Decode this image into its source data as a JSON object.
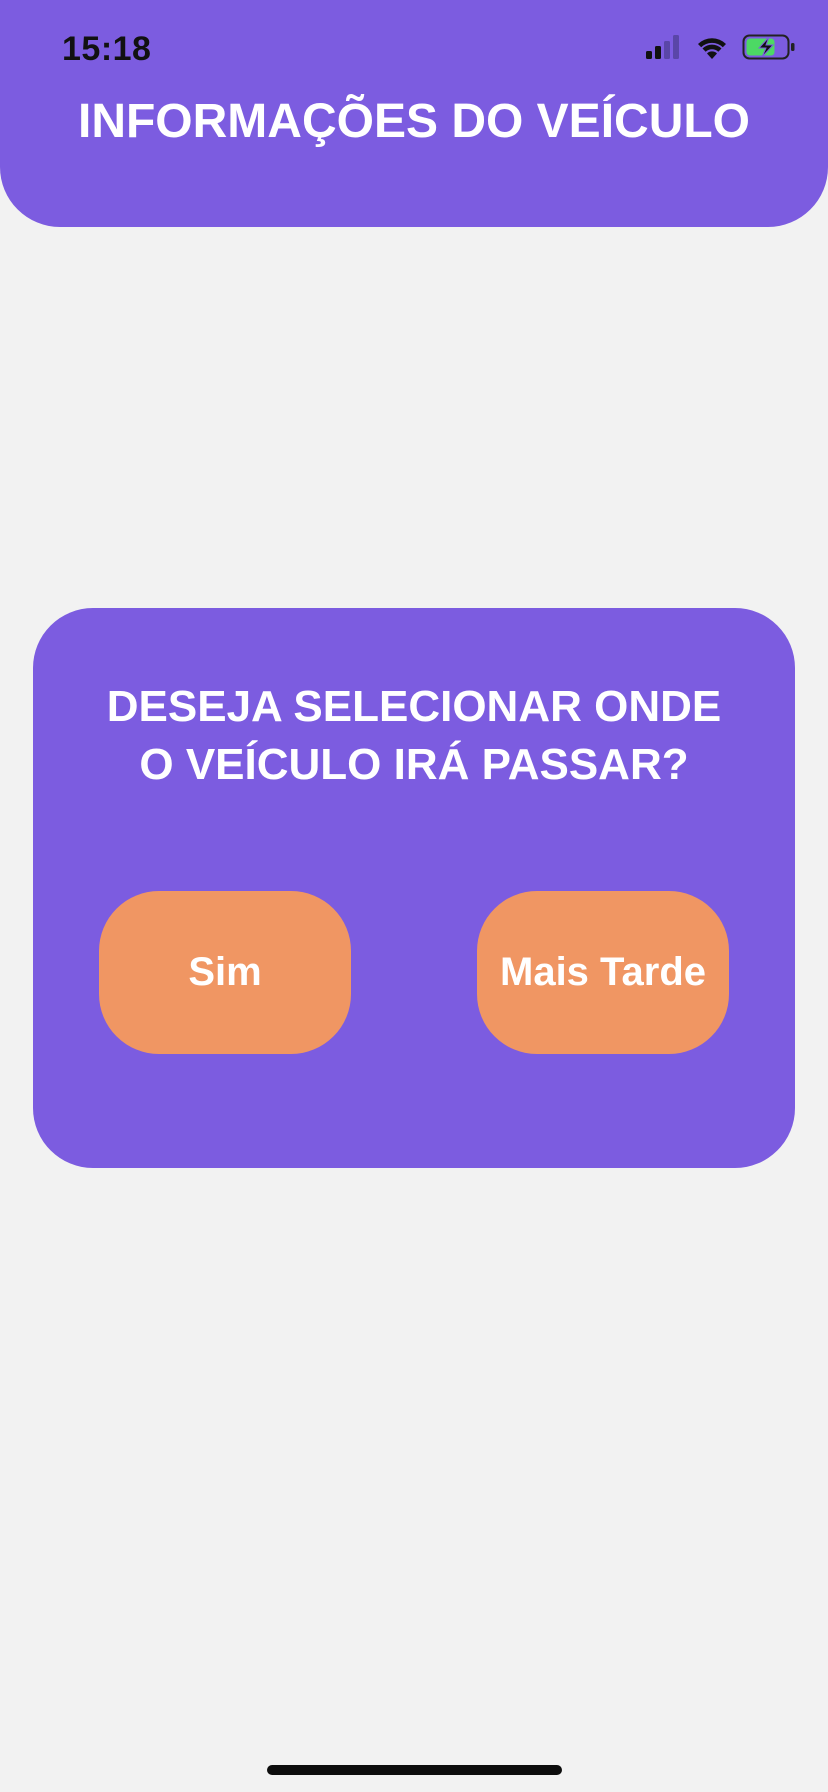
{
  "status_bar": {
    "time": "15:18",
    "icons": [
      "signal-icon",
      "wifi-icon",
      "battery-charging-icon"
    ],
    "battery_color": "#4cd964"
  },
  "header": {
    "title": "INFORMAÇÕES DO VEÍCULO",
    "background": "#7c5ce0"
  },
  "dialog": {
    "question": "DESEJA SELECIONAR ONDE O VEÍCULO IRÁ PASSAR?",
    "yes_label": "Sim",
    "later_label": "Mais Tarde",
    "button_color": "#f09663"
  },
  "colors": {
    "accent": "#7c5ce0",
    "page_background": "#f2f2f2"
  }
}
